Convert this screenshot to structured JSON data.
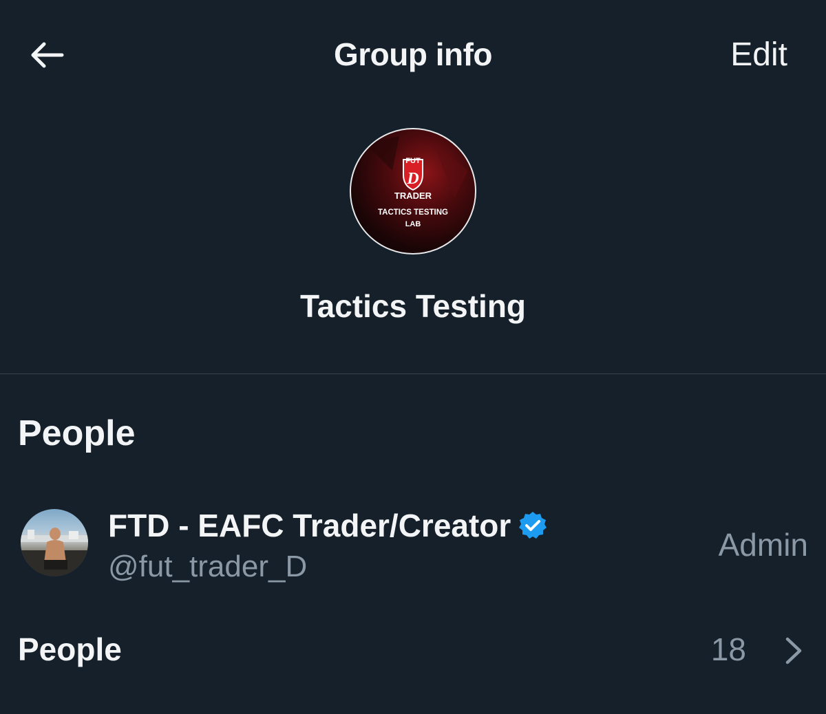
{
  "header": {
    "title": "Group info",
    "edit_label": "Edit",
    "back_icon": "arrow-left-icon"
  },
  "group": {
    "name": "Tactics Testing",
    "avatar": {
      "logo_top": "FUT",
      "logo_letter": "D",
      "logo_word": "TRADER",
      "line1": "TACTICS TESTING",
      "line2": "LAB"
    }
  },
  "people_section": {
    "heading": "People",
    "members": [
      {
        "name": "FTD - EAFC Trader/Creator",
        "handle": "@fut_trader_D",
        "role": "Admin",
        "verified": true,
        "verified_icon": "verified-badge-icon"
      }
    ],
    "all_people": {
      "label": "People",
      "count": "18",
      "icon": "chevron-right-icon"
    }
  },
  "colors": {
    "background": "#16202a",
    "text_primary": "#f2f4f5",
    "text_secondary": "#8b98a5",
    "divider": "#38444d",
    "verified": "#1d9bf0"
  }
}
